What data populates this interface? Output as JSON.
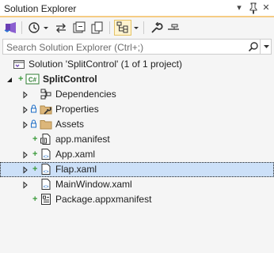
{
  "window": {
    "title": "Solution Explorer",
    "dropdown_glyph": "▾",
    "pin_glyph": "⊥",
    "close_glyph": "✕"
  },
  "toolbar": {
    "buttons": [
      "vs-icon",
      "history-icon",
      "dropdown-icon",
      "sync-icon",
      "collapse-icon",
      "copy-icon",
      "file-nesting-icon",
      "dropdown-icon",
      "wrench-icon",
      "preview-icon"
    ]
  },
  "search": {
    "placeholder": "Search Solution Explorer (Ctrl+;)"
  },
  "tree": {
    "solution": {
      "label": "Solution 'SplitControl' (1 of 1 project)"
    },
    "project": {
      "label": "SplitControl",
      "badge": "C#"
    },
    "items": [
      {
        "label": "Dependencies",
        "icon": "dependencies-icon"
      },
      {
        "label": "Properties",
        "icon": "properties-icon"
      },
      {
        "label": "Assets",
        "icon": "folder-icon"
      },
      {
        "label": "app.manifest",
        "icon": "manifest-icon"
      },
      {
        "label": "App.xaml",
        "icon": "xaml-icon"
      },
      {
        "label": "Flap.xaml",
        "icon": "xaml-icon",
        "selected": true
      },
      {
        "label": "MainWindow.xaml",
        "icon": "xaml-icon"
      },
      {
        "label": "Package.appxmanifest",
        "icon": "appxmanifest-icon"
      }
    ]
  },
  "colors": {
    "titlebar_accent": "#f5cc84",
    "selection": "#cce0f8",
    "add_status": "#3a9a3a",
    "lock_status": "#1e6ec8"
  }
}
